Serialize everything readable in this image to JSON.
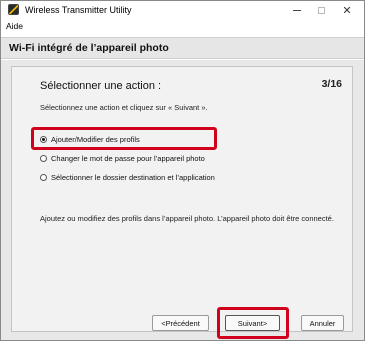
{
  "window": {
    "title": "Wireless Transmitter Utility",
    "controls": {
      "minimize": "–",
      "maximize": "□",
      "close": "✕"
    }
  },
  "menu": {
    "items": [
      "Aide"
    ]
  },
  "header": {
    "title": "Wi-Fi intégré de l’appareil photo"
  },
  "panel": {
    "heading": "Sélectionner une action :",
    "step": "3/16",
    "instruction": "Sélectionnez une action et cliquez sur « Suivant ».",
    "options": [
      {
        "label": "Ajouter/Modifier des profils",
        "selected": true
      },
      {
        "label": "Changer le mot de passe pour l’appareil photo",
        "selected": false
      },
      {
        "label": "Sélectionner le dossier destination et l’application",
        "selected": false
      }
    ],
    "description": "Ajoutez ou modifiez des profils dans l’appareil photo. L’appareil photo doit être connecté."
  },
  "buttons": {
    "previous": "<Précédent",
    "next": "Suivant>",
    "cancel": "Annuler"
  },
  "colors": {
    "highlight": "#d0021b",
    "header_bg": "#e6e6e6",
    "panel_bg": "#f2f2f2"
  }
}
